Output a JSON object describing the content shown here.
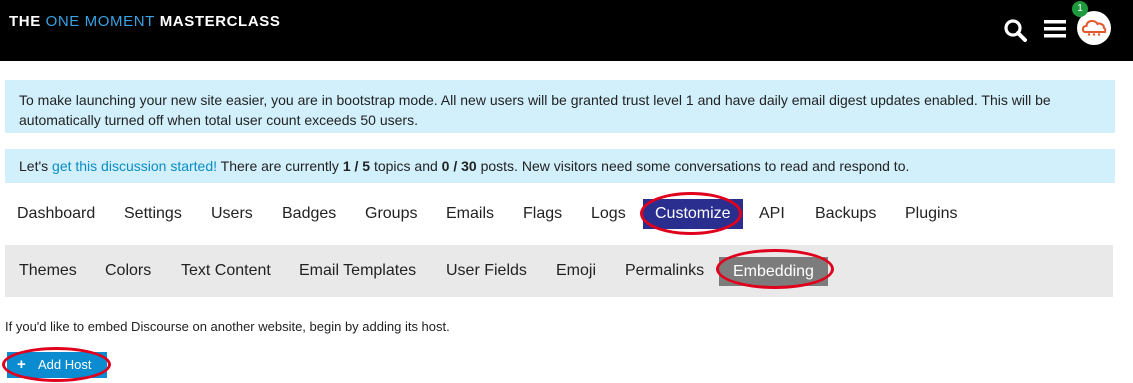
{
  "header": {
    "logo_part1": "THE ",
    "logo_accent": "ONE MOMENT",
    "logo_part2": " MASTERCLASS",
    "notification_count": "1",
    "icons": [
      "search-icon",
      "hamburger-menu-icon",
      "cloud-avatar"
    ]
  },
  "notices": {
    "bootstrap": "To make launching your new site easier, you are in bootstrap mode. All new users will be granted trust level 1 and have daily email digest updates enabled. This will be automatically turned off when total user count exceeds 50 users.",
    "discussion_prefix": "Let's ",
    "discussion_link": "get this discussion started!",
    "discussion_mid1": " There are currently ",
    "topics": "1 / 5",
    "discussion_mid2": " topics and ",
    "posts": "0 / 30",
    "discussion_suffix": " posts. New visitors need some conversations to read and respond to."
  },
  "main_tabs": [
    "Dashboard",
    "Settings",
    "Users",
    "Badges",
    "Groups",
    "Emails",
    "Flags",
    "Logs",
    "Customize",
    "API",
    "Backups",
    "Plugins"
  ],
  "active_main_tab": "Customize",
  "sub_tabs": [
    "Themes",
    "Colors",
    "Text Content",
    "Email Templates",
    "User Fields",
    "Emoji",
    "Permalinks",
    "Embedding"
  ],
  "active_sub_tab": "Embedding",
  "embedding": {
    "description": "If you'd like to embed Discourse on another website, begin by adding its host.",
    "add_host_label": "Add Host"
  },
  "colors": {
    "accent": "#3aa3e3",
    "active_tab": "#2a2f8f",
    "active_subtab": "#7c7c7c",
    "notice_bg": "#d1f0fc",
    "button": "#0b8bd0",
    "highlight_circle": "#e0001c"
  }
}
